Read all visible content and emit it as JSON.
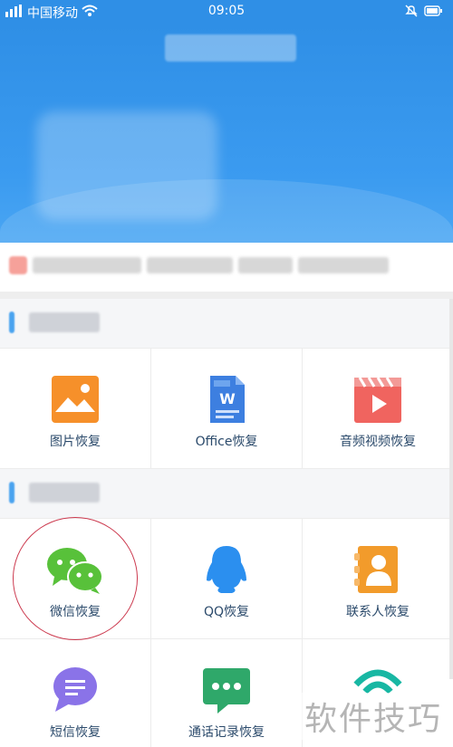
{
  "status_bar": {
    "carrier": "中国移动",
    "time": "09:05"
  },
  "sections": [
    {
      "items": [
        {
          "label": "图片恢复",
          "icon": "image-icon",
          "color": "#f6902a"
        },
        {
          "label": "Office恢复",
          "icon": "word-doc-icon",
          "color": "#3d7fe0"
        },
        {
          "label": "音频视频恢复",
          "icon": "video-icon",
          "color": "#f0645f"
        }
      ]
    },
    {
      "items": [
        {
          "label": "微信恢复",
          "icon": "wechat-icon",
          "color": "#58c13a"
        },
        {
          "label": "QQ恢复",
          "icon": "qq-icon",
          "color": "#2b8fef"
        },
        {
          "label": "联系人恢复",
          "icon": "contacts-icon",
          "color": "#f29b2b"
        }
      ]
    },
    {
      "items": [
        {
          "label": "短信恢复",
          "icon": "sms-icon",
          "color": "#8a73e8"
        },
        {
          "label": "通话记录恢复",
          "icon": "call-log-icon",
          "color": "#2fa86a"
        },
        {
          "label": "",
          "icon": "wifi-like-icon",
          "color": "#18b7a3"
        }
      ]
    }
  ],
  "watermark": "软件技巧",
  "highlight_color": "#cc3a4f",
  "brand_blue": "#2f8fe6"
}
